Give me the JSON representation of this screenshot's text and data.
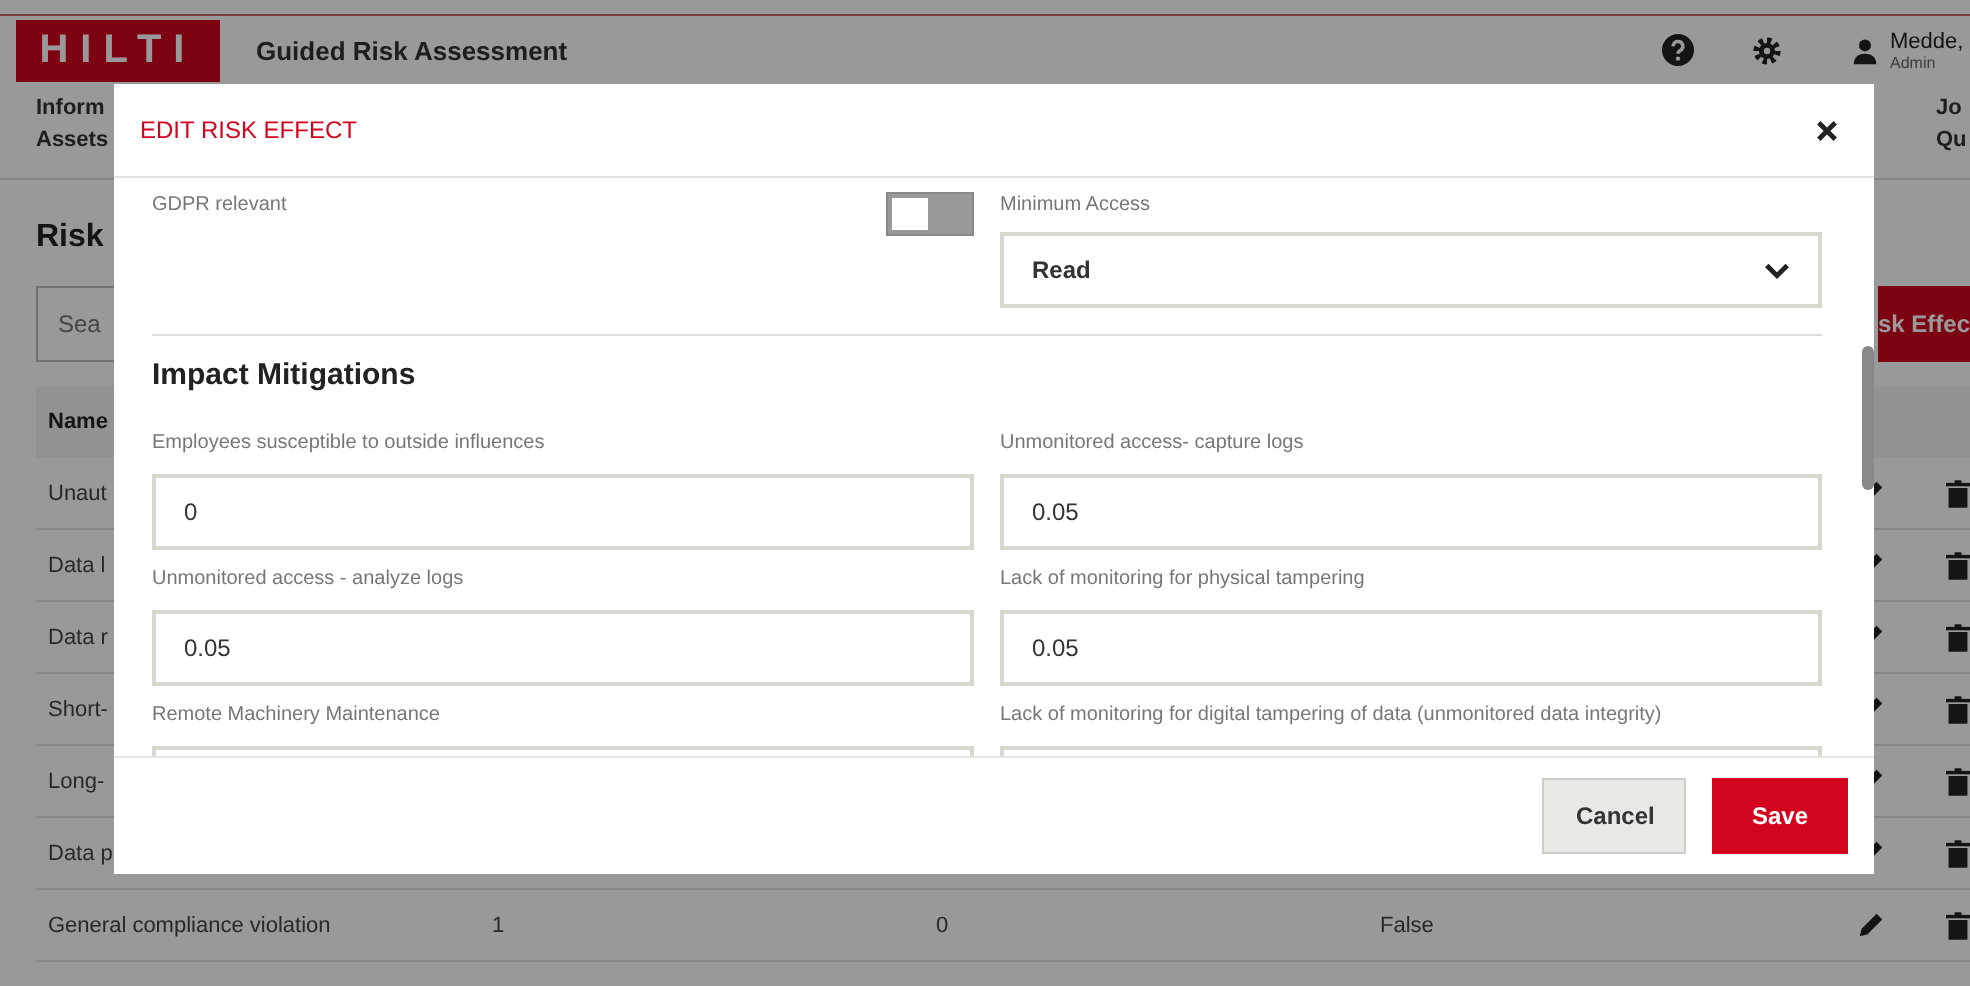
{
  "app": {
    "logo": "HILTI",
    "title": "Guided Risk Assessment",
    "user": {
      "name": "Medde,",
      "role": "Admin"
    }
  },
  "nav": {
    "left": [
      "Inform",
      "Assets"
    ],
    "right": [
      "Jo",
      "Qu"
    ]
  },
  "page": {
    "heading": "Risk",
    "search": {
      "placeholder": "Sea"
    },
    "add_button": "sk Effec"
  },
  "table": {
    "header": "Name",
    "rows": [
      {
        "cells": [
          "Unaut"
        ]
      },
      {
        "cells": [
          "Data l"
        ]
      },
      {
        "cells": [
          "Data r"
        ]
      },
      {
        "cells": [
          "Short-"
        ]
      },
      {
        "cells": [
          "Long-"
        ]
      },
      {
        "cells": [
          "Data p"
        ]
      },
      {
        "cells": [
          "General compliance violation",
          "1",
          "0",
          "False"
        ]
      }
    ]
  },
  "dialog": {
    "title": "EDIT RISK EFFECT",
    "gdpr": {
      "label": "GDPR relevant",
      "on": false
    },
    "minimum_access": {
      "label": "Minimum Access",
      "value": "Read"
    },
    "section": "Impact Mitigations",
    "fields": [
      {
        "label": "Employees susceptible to outside influences",
        "value": "0"
      },
      {
        "label": "Unmonitored access- capture logs",
        "value": "0.05"
      },
      {
        "label": "Unmonitored access - analyze logs",
        "value": "0.05"
      },
      {
        "label": "Lack of monitoring for physical tampering",
        "value": "0.05"
      },
      {
        "label": "Remote Machinery Maintenance"
      },
      {
        "label": "Lack of monitoring for digital tampering of data (unmonitored data integrity)"
      }
    ],
    "buttons": {
      "cancel": "Cancel",
      "save": "Save"
    }
  }
}
